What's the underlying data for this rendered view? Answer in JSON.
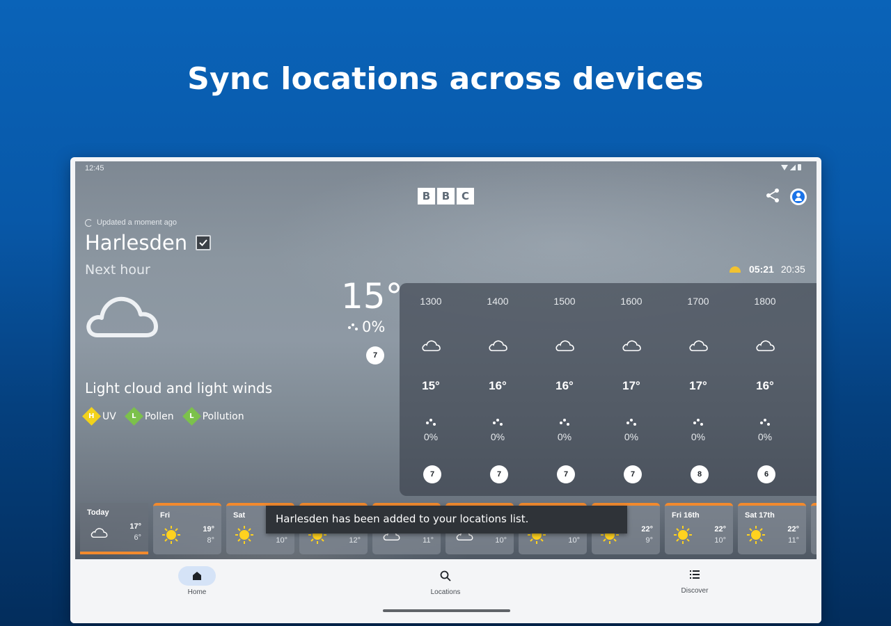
{
  "headline": "Sync locations across devices",
  "status_bar": {
    "time": "12:45"
  },
  "brand": {
    "letters": [
      "B",
      "B",
      "C"
    ]
  },
  "updated_text": "Updated a moment ago",
  "location": "Harlesden",
  "next_hour_label": "Next hour",
  "sunrise": "05:21",
  "sunset": "20:35",
  "current": {
    "temp": "15°",
    "rain": "0%",
    "wind": "7"
  },
  "description": "Light cloud and light winds",
  "indices": [
    {
      "letter": "H",
      "label": "UV",
      "color": "#f2d21b"
    },
    {
      "letter": "L",
      "label": "Pollen",
      "color": "#7cc14b"
    },
    {
      "letter": "L",
      "label": "Pollution",
      "color": "#7cc14b"
    }
  ],
  "hourly": [
    {
      "hour": "1300",
      "temp": "15°",
      "rain": "0%",
      "wind": "7"
    },
    {
      "hour": "1400",
      "temp": "16°",
      "rain": "0%",
      "wind": "7"
    },
    {
      "hour": "1500",
      "temp": "16°",
      "rain": "0%",
      "wind": "7"
    },
    {
      "hour": "1600",
      "temp": "17°",
      "rain": "0%",
      "wind": "7"
    },
    {
      "hour": "1700",
      "temp": "17°",
      "rain": "0%",
      "wind": "8"
    },
    {
      "hour": "1800",
      "temp": "16°",
      "rain": "0%",
      "wind": "6"
    }
  ],
  "daily": [
    {
      "day": "Today",
      "high": "17°",
      "low": "6°",
      "icon": "cloud-icon"
    },
    {
      "day": "Fri",
      "high": "19°",
      "low": "8°",
      "icon": "sun-icon"
    },
    {
      "day": "Sat",
      "high": "",
      "low": "10°",
      "icon": "sun-icon"
    },
    {
      "day": "",
      "high": "",
      "low": "12°",
      "icon": "sun-icon"
    },
    {
      "day": "",
      "high": "",
      "low": "11°",
      "icon": "cloud-icon"
    },
    {
      "day": "",
      "high": "",
      "low": "10°",
      "icon": "cloud-icon"
    },
    {
      "day": "",
      "high": "",
      "low": "10°",
      "icon": "sun-icon"
    },
    {
      "day": "",
      "high": "22°",
      "low": "9°",
      "icon": "sun-icon"
    },
    {
      "day": "Fri 16th",
      "high": "22°",
      "low": "10°",
      "icon": "sun-icon"
    },
    {
      "day": "Sat 17th",
      "high": "22°",
      "low": "11°",
      "icon": "sun-icon"
    }
  ],
  "toast": "Harlesden has been added to your locations list.",
  "nav": [
    {
      "label": "Home",
      "icon": "home-icon"
    },
    {
      "label": "Locations",
      "icon": "search-icon"
    },
    {
      "label": "Discover",
      "icon": "list-icon"
    }
  ]
}
